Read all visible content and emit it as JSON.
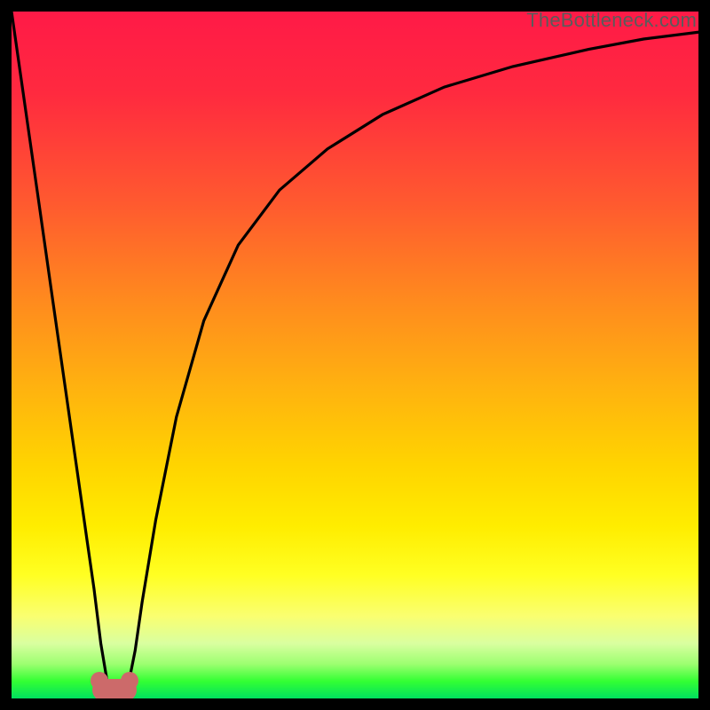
{
  "watermark": "TheBottleneck.com",
  "colors": {
    "frame": "#000000",
    "gradient_top": "#ff1a47",
    "gradient_bottom": "#00e060",
    "curve": "#000000",
    "blob": "#cc6a6a",
    "watermark": "#5b5b5b"
  },
  "chart_data": {
    "type": "line",
    "title": "",
    "xlabel": "",
    "ylabel": "",
    "xlim": [
      0,
      100
    ],
    "ylim": [
      0,
      100
    ],
    "series": [
      {
        "name": "bottleneck-curve",
        "x": [
          0,
          2,
          4,
          6,
          8,
          10,
          11,
          12,
          13,
          14,
          15,
          16,
          17,
          18,
          19,
          21,
          24,
          28,
          33,
          39,
          46,
          54,
          63,
          73,
          84,
          92,
          100
        ],
        "y": [
          100,
          86,
          72,
          58,
          44,
          30,
          23,
          16,
          8,
          2,
          0,
          0,
          2,
          7,
          14,
          26,
          41,
          55,
          66,
          74,
          80,
          85,
          89,
          92,
          94.5,
          96,
          97
        ]
      }
    ],
    "annotations": [
      {
        "name": "min-blob",
        "x": 15,
        "y": 0
      }
    ],
    "grid": false,
    "legend": false
  }
}
